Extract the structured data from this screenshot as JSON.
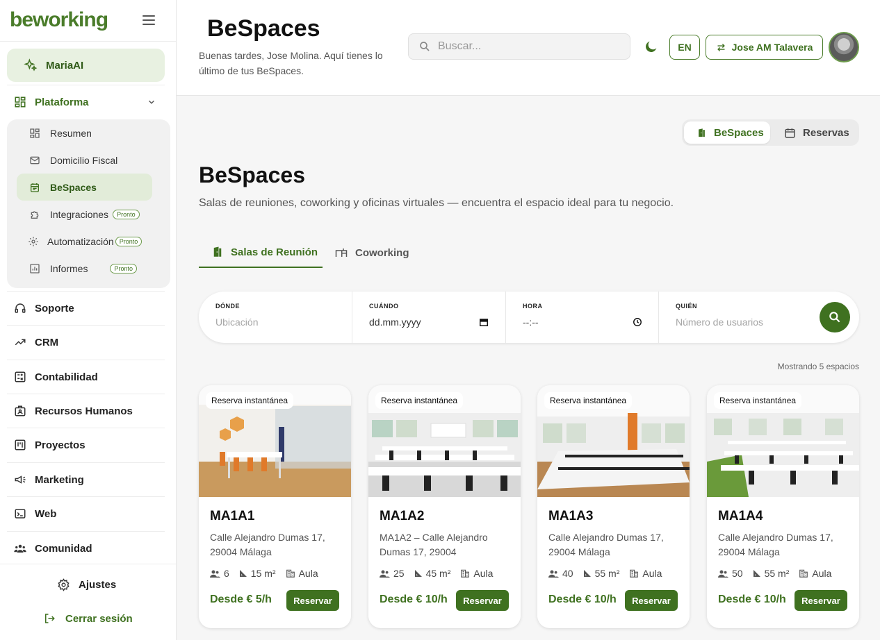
{
  "brand": {
    "logo_text": "beworking",
    "accent": "#3f7120"
  },
  "sidebar": {
    "maria": {
      "label": "MariaAI",
      "icon": "sparkle-icon"
    },
    "platform": {
      "label": "Plataforma",
      "icon": "dashboard-icon"
    },
    "sub_items": [
      {
        "label": "Resumen",
        "icon": "grid-icon",
        "badge": ""
      },
      {
        "label": "Domicilio Fiscal",
        "icon": "mail-icon",
        "badge": ""
      },
      {
        "label": "BeSpaces",
        "icon": "calendar-icon",
        "badge": "",
        "active": true
      },
      {
        "label": "Integraciones",
        "icon": "puzzle-icon",
        "badge": "Pronto"
      },
      {
        "label": "Automatización",
        "icon": "gear-icon",
        "badge": "Pronto"
      },
      {
        "label": "Informes",
        "icon": "chart-icon",
        "badge": "Pronto"
      }
    ],
    "nav_items": [
      {
        "label": "Soporte",
        "icon": "headset-icon"
      },
      {
        "label": "CRM",
        "icon": "trend-icon"
      },
      {
        "label": "Contabilidad",
        "icon": "calculator-icon"
      },
      {
        "label": "Recursos Humanos",
        "icon": "badge-icon"
      },
      {
        "label": "Proyectos",
        "icon": "kanban-icon"
      },
      {
        "label": "Marketing",
        "icon": "megaphone-icon"
      },
      {
        "label": "Web",
        "icon": "terminal-icon"
      },
      {
        "label": "Comunidad",
        "icon": "group-icon"
      }
    ],
    "settings_label": "Ajustes",
    "logout_label": "Cerrar sesión"
  },
  "header": {
    "title": "BeSpaces",
    "greeting": "Buenas tardes, Jose Molina. Aquí tienes lo último de tus BeSpaces.",
    "search_placeholder": "Buscar...",
    "lang_label": "EN",
    "user_label": "Jose AM Talavera"
  },
  "main": {
    "toggle": {
      "active": "BeSpaces",
      "inactive": "Reservas"
    },
    "title": "BeSpaces",
    "subtitle": "Salas de reuniones, coworking y oficinas virtuales — encuentra el espacio ideal para tu negocio.",
    "tabs": [
      {
        "label": "Salas de Reunión"
      },
      {
        "label": "Coworking"
      }
    ],
    "filters": {
      "where_label": "DÓNDE",
      "where_placeholder": "Ubicación",
      "when_label": "CUÁNDO",
      "when_value": "dd.mm.yyyy",
      "hour_label": "HORA",
      "hour_value": "--:--",
      "who_label": "QUIÉN",
      "who_placeholder": "Número de usuarios"
    },
    "count_text": "Mostrando 5 espacios",
    "cards": [
      {
        "badge": "Reserva instantánea",
        "name": "MA1A1",
        "address": "Calle Alejandro Dumas 17, 29004 Málaga",
        "capacity": "6",
        "area": "15 m²",
        "type": "Aula",
        "price": "Desde € 5/h",
        "button": "Reservar"
      },
      {
        "badge": "Reserva instantánea",
        "name": "MA1A2",
        "address": "MA1A2 – Calle Alejandro Dumas 17, 29004",
        "capacity": "25",
        "area": "45 m²",
        "type": "Aula",
        "price": "Desde € 10/h",
        "button": "Reservar"
      },
      {
        "badge": "Reserva instantánea",
        "name": "MA1A3",
        "address": "Calle Alejandro Dumas 17, 29004 Málaga",
        "capacity": "40",
        "area": "55 m²",
        "type": "Aula",
        "price": "Desde € 10/h",
        "button": "Reservar"
      },
      {
        "badge": "Reserva instantánea",
        "name": "MA1A4",
        "address": "Calle Alejandro Dumas 17, 29004 Málaga",
        "capacity": "50",
        "area": "55 m²",
        "type": "Aula",
        "price": "Desde € 10/h",
        "button": "Reservar"
      }
    ]
  }
}
